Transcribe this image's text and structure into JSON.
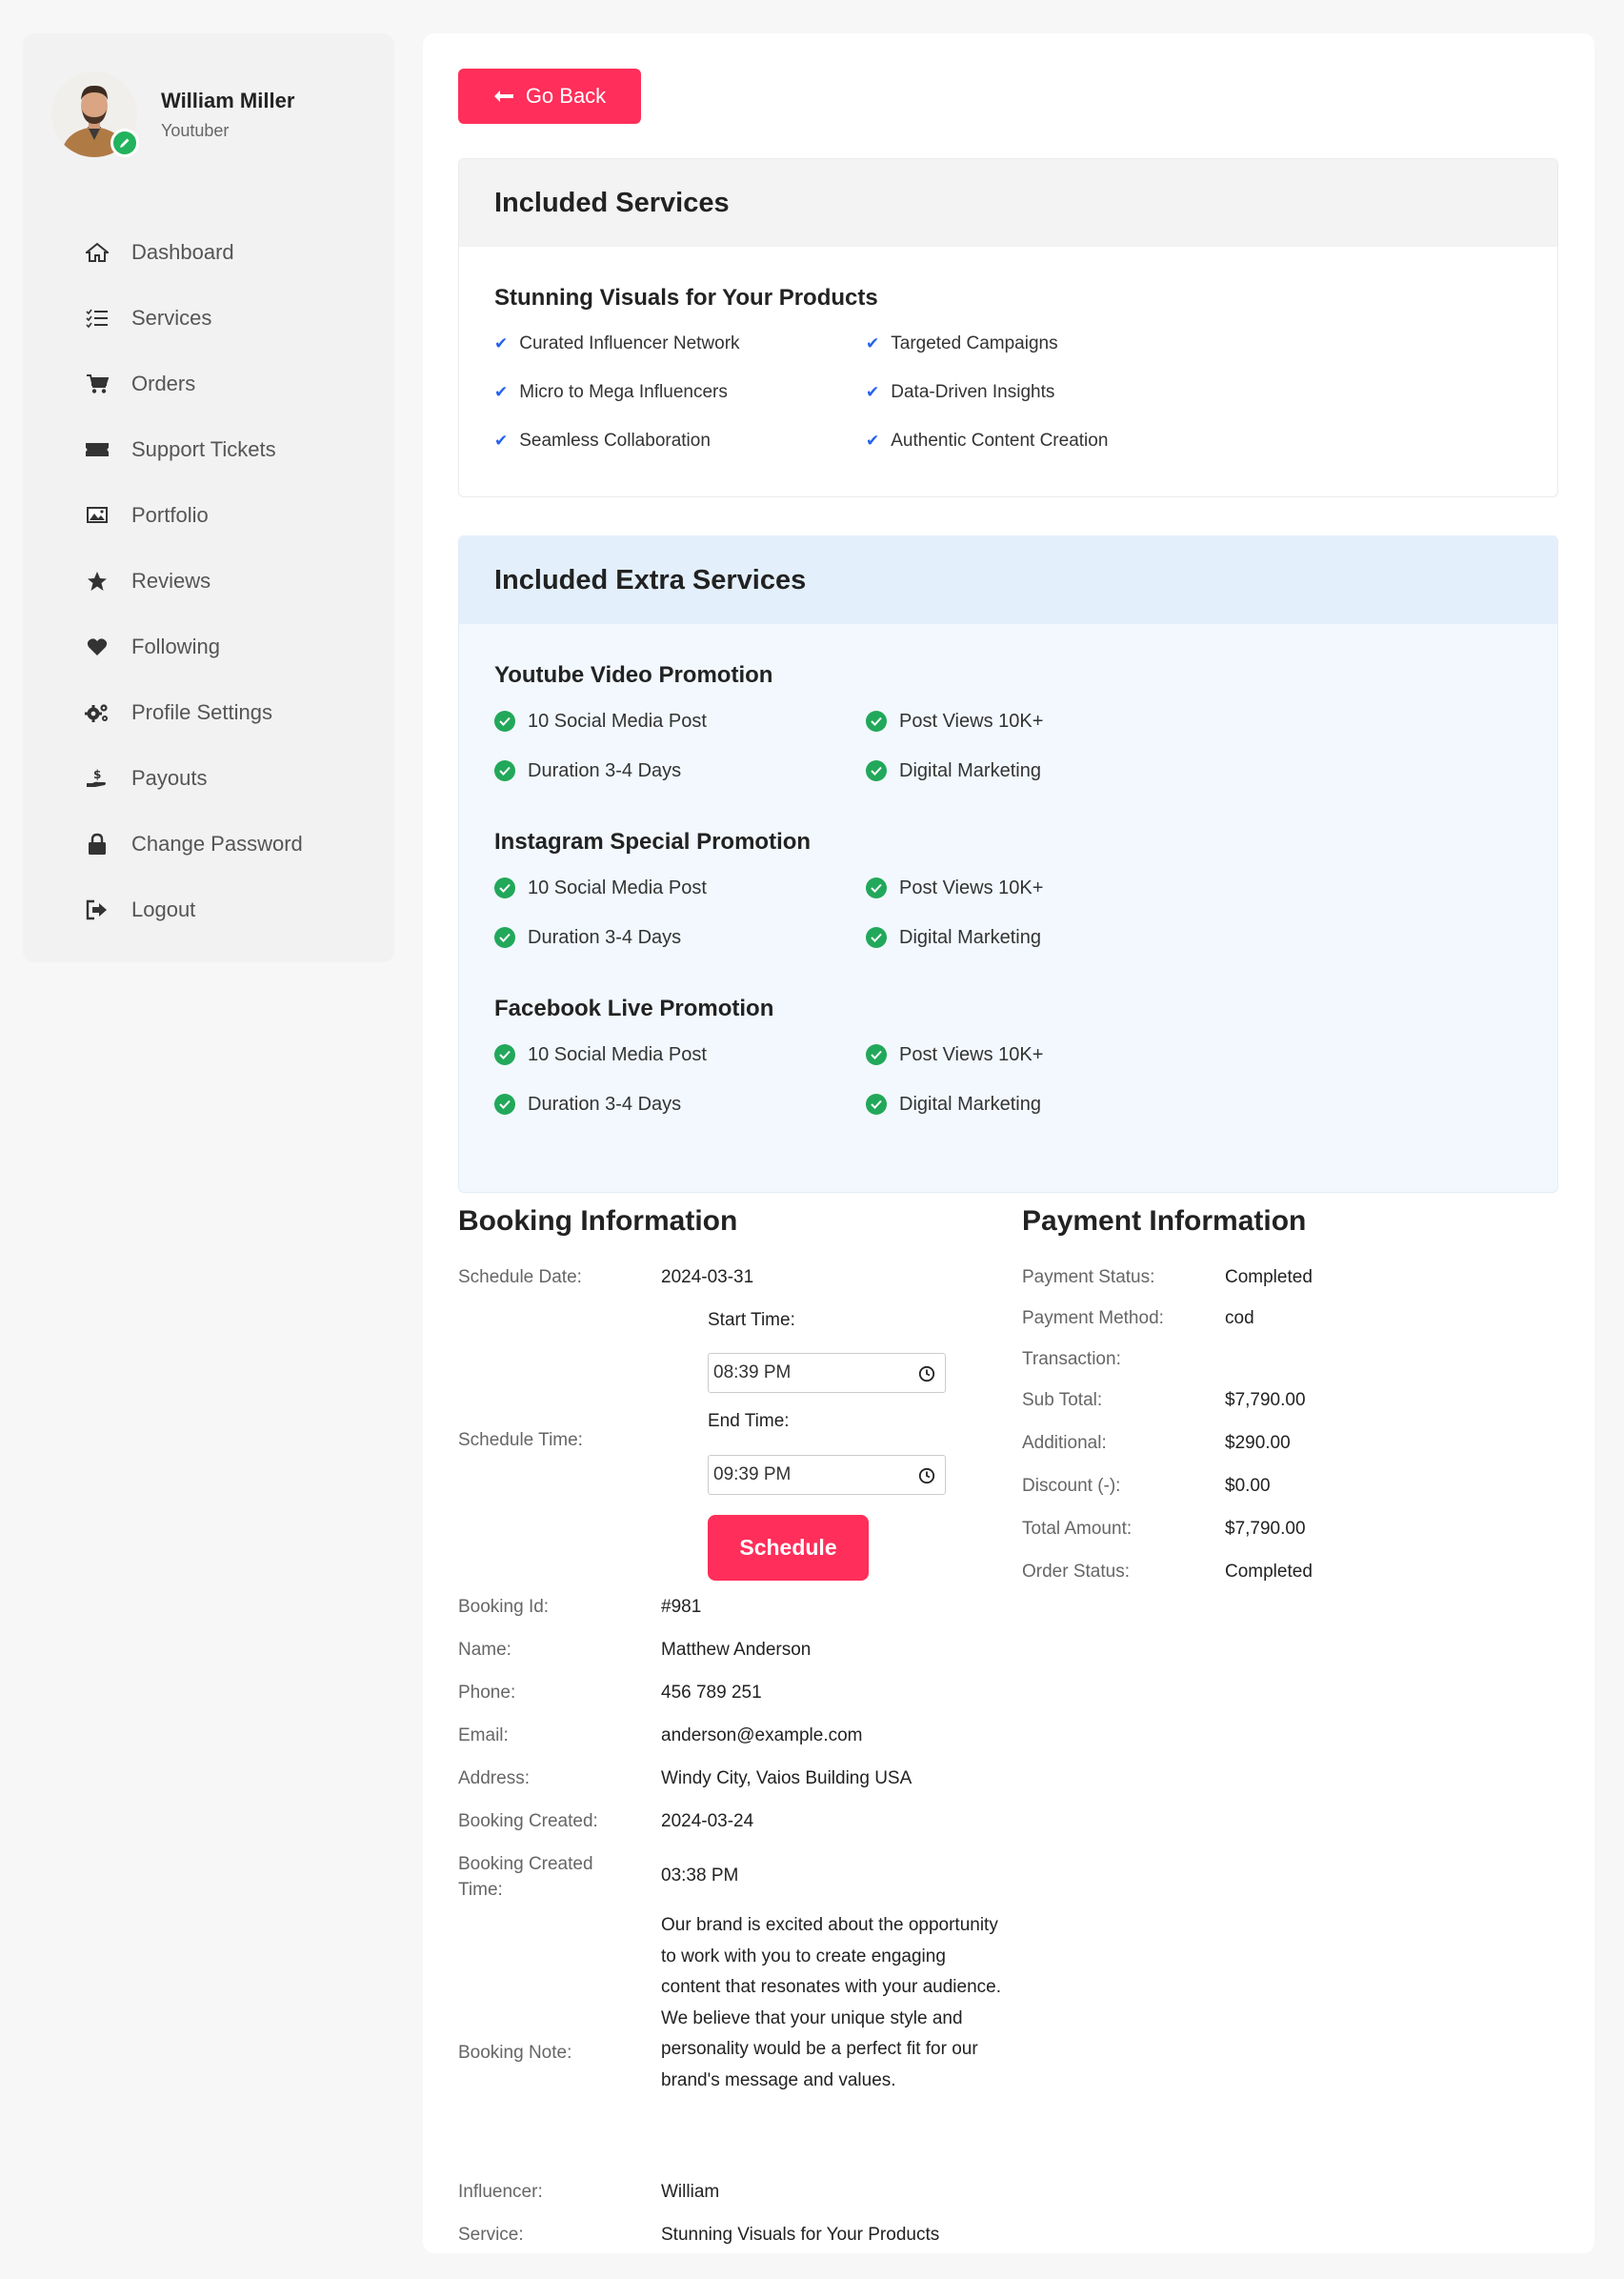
{
  "profile": {
    "name": "William Miller",
    "role": "Youtuber"
  },
  "nav": [
    {
      "label": "Dashboard",
      "icon": "home-icon"
    },
    {
      "label": "Services",
      "icon": "list-icon"
    },
    {
      "label": "Orders",
      "icon": "cart-icon"
    },
    {
      "label": "Support Tickets",
      "icon": "ticket-icon"
    },
    {
      "label": "Portfolio",
      "icon": "image-icon"
    },
    {
      "label": "Reviews",
      "icon": "star-icon"
    },
    {
      "label": "Following",
      "icon": "heart-icon"
    },
    {
      "label": "Profile Settings",
      "icon": "gears-icon"
    },
    {
      "label": "Payouts",
      "icon": "payout-icon"
    },
    {
      "label": "Change Password",
      "icon": "lock-icon"
    },
    {
      "label": "Logout",
      "icon": "logout-icon"
    }
  ],
  "go_back": "Go Back",
  "included": {
    "heading": "Included Services",
    "title": "Stunning Visuals for Your Products",
    "items": [
      "Curated Influencer Network",
      "Targeted Campaigns",
      "Micro to Mega Influencers",
      "Data-Driven Insights",
      "Seamless Collaboration",
      "Authentic Content Creation"
    ]
  },
  "extra": {
    "heading": "Included Extra Services",
    "groups": [
      {
        "title": "Youtube Video Promotion",
        "items": [
          "10 Social Media Post",
          "Post Views 10K+",
          "Duration 3-4 Days",
          "Digital Marketing"
        ]
      },
      {
        "title": "Instagram Special Promotion",
        "items": [
          "10 Social Media Post",
          "Post Views 10K+",
          "Duration 3-4 Days",
          "Digital Marketing"
        ]
      },
      {
        "title": "Facebook Live Promotion",
        "items": [
          "10 Social Media Post",
          "Post Views 10K+",
          "Duration 3-4 Days",
          "Digital Marketing"
        ]
      }
    ]
  },
  "booking": {
    "heading": "Booking Information",
    "schedule_date_label": "Schedule Date:",
    "schedule_date": "2024-03-31",
    "schedule_time_label": "Schedule Time:",
    "start_time_label": "Start Time:",
    "start_time": "08:39  PM",
    "end_time_label": "End Time:",
    "end_time": "09:39  PM",
    "schedule_button": "Schedule",
    "booking_id_label": "Booking Id:",
    "booking_id": "#981",
    "name_label": "Name:",
    "name": "Matthew Anderson",
    "phone_label": "Phone:",
    "phone": "456 789 251",
    "email_label": "Email:",
    "email": "anderson@example.com",
    "address_label": "Address:",
    "address": "Windy City, Vaios Building USA",
    "created_label": "Booking Created:",
    "created": "2024-03-24",
    "created_time_label_1": "Booking Created",
    "created_time_label_2": "Time:",
    "created_time": "03:38 PM",
    "note_label": "Booking Note:",
    "note": "Our brand is excited about the opportunity to work with you to create engaging content that resonates with your audience. We believe that your unique style and personality would be a perfect fit for our brand's message and values.",
    "influencer_label": "Influencer:",
    "influencer": "William",
    "service_label": "Service:",
    "service": "Stunning Visuals for Your Products"
  },
  "payment": {
    "heading": "Payment Information",
    "rows": [
      {
        "label": "Payment Status:",
        "value": "Completed"
      },
      {
        "label": "Payment Method:",
        "value": "cod"
      },
      {
        "label": "Transaction:",
        "value": ""
      },
      {
        "label": "Sub Total:",
        "value": "$7,790.00"
      },
      {
        "label": "Additional:",
        "value": "$290.00"
      },
      {
        "label": "Discount (-):",
        "value": "$0.00"
      },
      {
        "label": "Total Amount:",
        "value": "$7,790.00"
      },
      {
        "label": "Order Status:",
        "value": "Completed"
      }
    ]
  },
  "colors": {
    "accent": "#ff2e5a",
    "success": "#22a85a",
    "tick": "#2563eb"
  }
}
